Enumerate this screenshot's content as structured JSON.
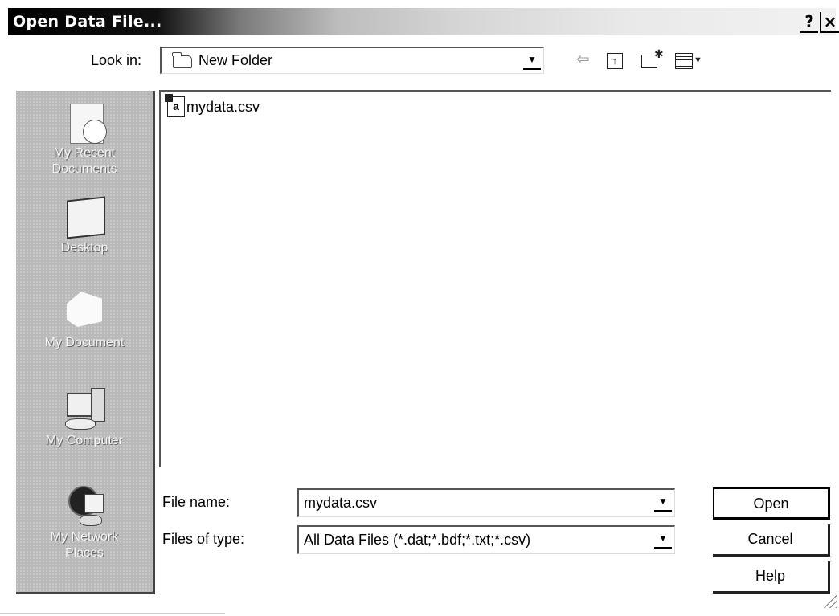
{
  "window": {
    "title": "Open Data File...",
    "help_glyph": "?",
    "close_glyph": "×"
  },
  "look_in": {
    "label": "Look in:",
    "value": "New Folder",
    "folder_icon": "folder-icon"
  },
  "toolbar": {
    "icons": [
      "back-arrow-icon",
      "up-one-level-icon",
      "new-folder-icon",
      "views-menu-icon"
    ]
  },
  "places_bar": {
    "items": [
      {
        "label_lines": [
          "My Recent",
          "Documents"
        ],
        "icon": "recent-documents-icon"
      },
      {
        "label_lines": [
          "Desktop"
        ],
        "icon": "desktop-icon"
      },
      {
        "label_lines": [
          "My Document"
        ],
        "icon": "my-documents-icon"
      },
      {
        "label_lines": [
          "My Computer"
        ],
        "icon": "my-computer-icon"
      },
      {
        "label_lines": [
          "My Network",
          "Places"
        ],
        "icon": "my-network-places-icon"
      }
    ]
  },
  "file_list": {
    "items": [
      {
        "name": "mydata.csv",
        "icon": "csv-file-icon"
      }
    ]
  },
  "file_name": {
    "label": "File name:",
    "value": "mydata.csv"
  },
  "files_of_type": {
    "label": "Files of type:",
    "value": "All Data Files (*.dat;*.bdf;*.txt;*.csv)"
  },
  "buttons": {
    "open": "Open",
    "cancel": "Cancel",
    "help": "Help"
  }
}
